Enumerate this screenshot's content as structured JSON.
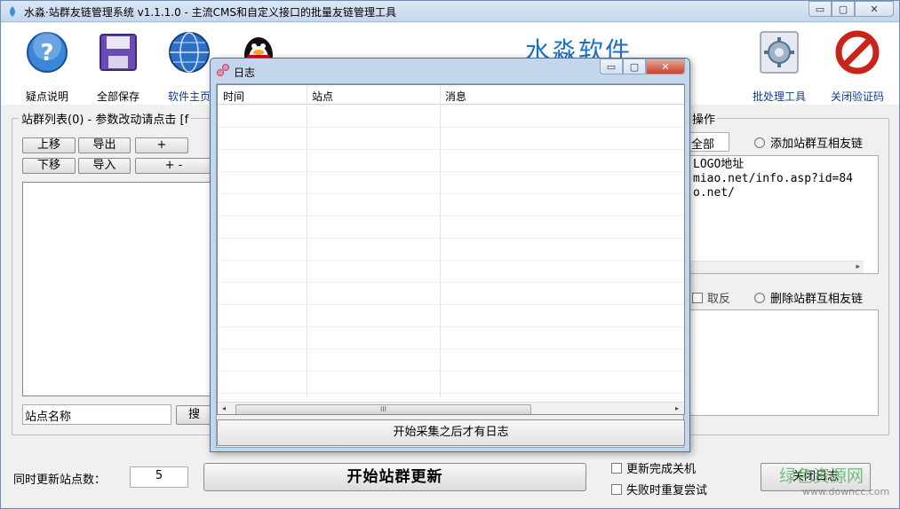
{
  "window": {
    "title": "水淼·站群友链管理系统 v1.1.1.0 - 主流CMS和自定义接口的批量友链管理工具",
    "controls": {
      "minimize": "▭",
      "maximize": "▢",
      "close": "✕"
    }
  },
  "toolbar": {
    "help": "疑点说明",
    "save_all": "全部保存",
    "homepage": "软件主页",
    "brand": "水淼软件",
    "batch_tools": "批处理工具",
    "close_captcha": "关闭验证码"
  },
  "left_panel": {
    "group_label": "站群列表(0) - 参数改动请点击 [f",
    "btn_up": "上移",
    "btn_export": "导出",
    "btn_plus": "+",
    "btn_down": "下移",
    "btn_import": "导入",
    "btn_plus_minus": "+ -",
    "search_field": "站点名称",
    "search_button": "搜"
  },
  "right_panel": {
    "group_label": "操作",
    "all_field": "全部",
    "add_radio": "添加站群互相友链",
    "link_text": "LOGO地址\nmiao.net/info.asp?id=84\no.net/",
    "invert_check": "取反",
    "delete_radio": "删除站群互相友链"
  },
  "bottom": {
    "concurrent_label": "同时更新站点数：",
    "concurrent_value": "5",
    "start_button": "开始站群更新",
    "shutdown_check": "更新完成关机",
    "retry_check": "失败时重复尝试",
    "close_log_button": "关闭日志"
  },
  "log_dialog": {
    "title": "日志",
    "columns": [
      "时间",
      "站点",
      "消息"
    ],
    "scroll_grip": "III",
    "status": "开始采集之后才有日志"
  },
  "watermark": {
    "text": "绿色资源网",
    "url": "www.downcc.com"
  }
}
